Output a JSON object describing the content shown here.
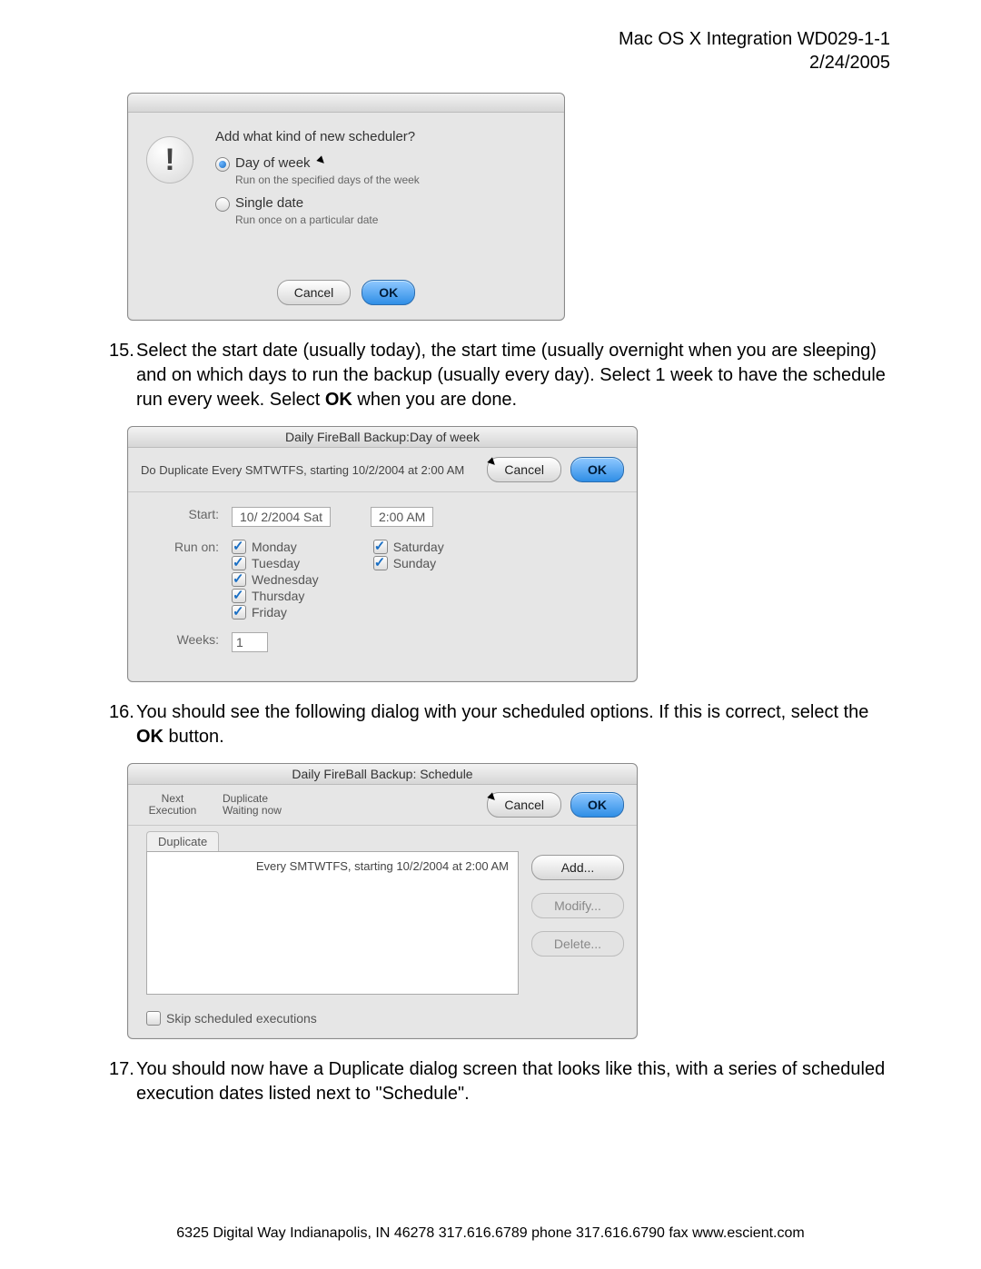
{
  "header": {
    "title": "Mac OS X Integration WD029-1-1",
    "date": "2/24/2005"
  },
  "dialog1": {
    "prompt": "Add what kind of new scheduler?",
    "opt1_label": "Day of week",
    "opt1_sub": "Run on the specified days of the week",
    "opt2_label": "Single date",
    "opt2_sub": "Run once on a particular date",
    "cancel": "Cancel",
    "ok": "OK"
  },
  "step15": {
    "num": "15.",
    "text_a": "Select the start date (usually today), the start time (usually overnight when you are sleeping) and on which days to run the backup (usually every day). Select 1 week to have the schedule run every week. Select ",
    "bold": "OK",
    "text_b": " when you are done."
  },
  "dialog2": {
    "title": "Daily FireBall Backup:Day of week",
    "summary": "Do Duplicate Every SMTWTFS, starting 10/2/2004 at 2:00 AM",
    "cancel": "Cancel",
    "ok": "OK",
    "start_label": "Start:",
    "start_date": "10/ 2/2004 Sat",
    "start_time": "2:00  AM",
    "runon_label": "Run on:",
    "days_col1": [
      "Monday",
      "Tuesday",
      "Wednesday",
      "Thursday",
      "Friday"
    ],
    "days_col2": [
      "Saturday",
      "Sunday"
    ],
    "weeks_label": "Weeks:",
    "weeks_value": "1"
  },
  "step16": {
    "num": "16.",
    "text_a": "You should see the following dialog with your scheduled options. If this is correct, select the ",
    "bold": "OK",
    "text_b": " button."
  },
  "dialog3": {
    "title": "Daily FireBall Backup: Schedule",
    "col1_a": "Next",
    "col1_b": "Execution",
    "col2_a": "Duplicate",
    "col2_b": "Waiting now",
    "cancel": "Cancel",
    "ok": "OK",
    "tab": "Duplicate",
    "entry": "Every SMTWTFS, starting 10/2/2004 at 2:00 AM",
    "add": "Add...",
    "modify": "Modify...",
    "delete": "Delete...",
    "skip": "Skip scheduled executions"
  },
  "step17": {
    "num": "17.",
    "text": "You should now have a Duplicate dialog screen that looks like this, with a series of scheduled execution dates listed next to \"Schedule\"."
  },
  "footer": "6325 Digital Way   Indianapolis, IN 46278   317.616.6789 phone   317.616.6790 fax   www.escient.com"
}
